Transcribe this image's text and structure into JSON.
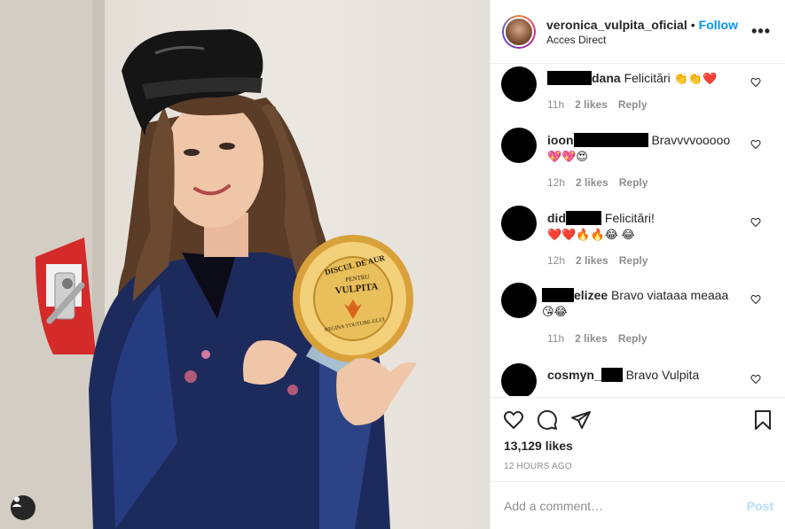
{
  "post": {
    "username": "veronica_vulpita_oficial",
    "separator": "•",
    "follow_label": "Follow",
    "location": "Acces Direct",
    "more_label": "•••",
    "likes": "13,129 likes",
    "time": "12 HOURS AGO"
  },
  "photo": {
    "trophy_top": "DISCUL DE AUR",
    "trophy_pentru": "PENTRU",
    "trophy_name": "VULPITA",
    "trophy_bottom": "REGINA YOUTUBE-ULUI"
  },
  "comments": [
    {
      "user": "dana",
      "text": "Felicitări",
      "emojis": "👏👏❤️",
      "time": "11h",
      "likes": "2 likes",
      "reply": "Reply"
    },
    {
      "user": "ioon",
      "text": "Bravvvvooooo",
      "emojis": "💖💖😍",
      "time": "12h",
      "likes": "2 likes",
      "reply": "Reply"
    },
    {
      "user": "did",
      "text": "Felicitări!",
      "emojis": "❤️❤️🔥🔥😂 😂",
      "time": "12h",
      "likes": "2 likes",
      "reply": "Reply"
    },
    {
      "user": "elizee",
      "text": "Bravo viataaa meaaa",
      "emojis": "😘😂",
      "time": "11h",
      "likes": "2 likes",
      "reply": "Reply"
    },
    {
      "user": "cosmyn_",
      "text": "Bravo Vulpita",
      "emojis": "",
      "time": "",
      "likes": "",
      "reply": ""
    }
  ],
  "comment_box": {
    "placeholder": "Add a comment…",
    "post_label": "Post"
  },
  "colors": {
    "follow": "#0095f6",
    "post_disabled": "#b2dffc",
    "muted": "#8e8e8e"
  }
}
